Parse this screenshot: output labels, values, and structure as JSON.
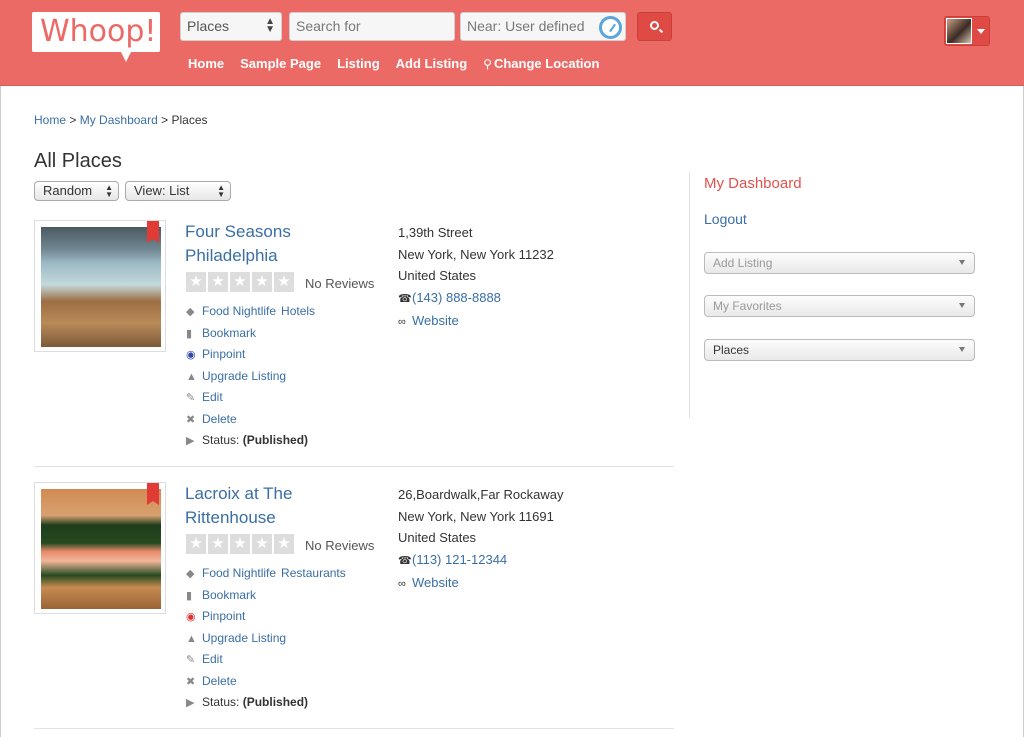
{
  "header": {
    "logo_text": "Whoop!",
    "category_select": "Places",
    "search_placeholder": "Search for",
    "near_placeholder": "Near: User defined",
    "nav": [
      "Home",
      "Sample Page",
      "Listing",
      "Add Listing",
      "Change Location"
    ]
  },
  "breadcrumb": {
    "home": "Home",
    "sep1": ">",
    "dashboard": "My Dashboard",
    "sep2": ">",
    "current": "Places"
  },
  "main": {
    "title": "All Places",
    "sort_select": "Random",
    "view_select": "View: List"
  },
  "listings": [
    {
      "name": "Four Seasons Philadelphia",
      "reviews": "No Reviews",
      "tags": [
        "Food Nightlife",
        "Hotels"
      ],
      "actions": {
        "bookmark": "Bookmark",
        "pinpoint": "Pinpoint",
        "upgrade": "Upgrade Listing",
        "edit": "Edit",
        "delete": "Delete"
      },
      "status_label": "Status:",
      "status_value": "(Published)",
      "address": [
        "1,39th Street",
        "New York, New York 11232",
        "United States"
      ],
      "phone": "(143) 888-8888",
      "website": "Website"
    },
    {
      "name": "Lacroix at The Rittenhouse",
      "reviews": "No Reviews",
      "tags": [
        "Food Nightlife",
        "Restaurants"
      ],
      "actions": {
        "bookmark": "Bookmark",
        "pinpoint": "Pinpoint",
        "upgrade": "Upgrade Listing",
        "edit": "Edit",
        "delete": "Delete"
      },
      "status_label": "Status:",
      "status_value": "(Published)",
      "address": [
        "26,Boardwalk,Far Rockaway",
        "New York, New York 11691",
        "United States"
      ],
      "phone": "(113) 121-12344",
      "website": "Website"
    }
  ],
  "sidebar": {
    "title": "My Dashboard",
    "logout": "Logout",
    "selects": [
      "Add Listing",
      "My Favorites",
      "Places"
    ]
  },
  "colors": {
    "brand": "#ec6a66",
    "link": "#3a6ea5",
    "accent_button": "#e04a45"
  }
}
